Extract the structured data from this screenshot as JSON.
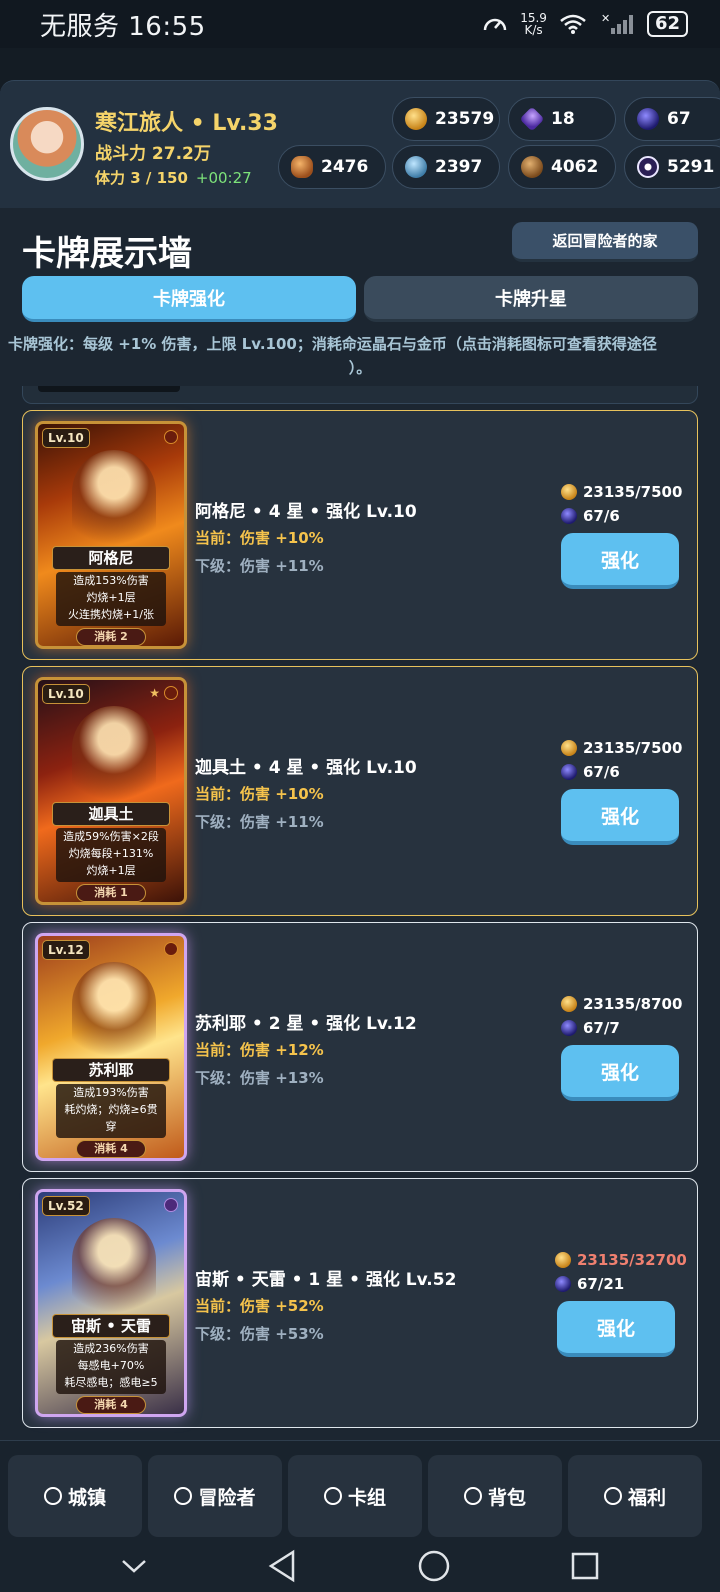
{
  "status_bar": {
    "carrier_time": "无服务 16:55",
    "net_speed_value": "15.9",
    "net_speed_unit": "K/s",
    "battery": "62"
  },
  "player": {
    "name": "寒江旅人 • Lv.33",
    "power": "战斗力 27.2万",
    "stamina": "体力 3 / 150",
    "stamina_timer": "+00:27"
  },
  "resources": {
    "gold": "23579",
    "gem": "18",
    "orb": "67",
    "bread": "2476",
    "crystal": "2397",
    "wood": "4062",
    "dark": "5291"
  },
  "page": {
    "title": "卡牌展示墙",
    "back_button": "返回冒险者的家",
    "tabs": [
      "卡牌强化",
      "卡牌升星"
    ],
    "active_tab": "卡牌强化",
    "hint_line1": "卡牌强化：每级 +1% 伤害，上限 Lv.100；消耗命运晶石与金币（点击消耗图标可查看获得途径",
    "hint_line2": "）。"
  },
  "cards": [
    {
      "level_badge": "Lv.10",
      "name": "阿格尼",
      "effect": [
        "造成153%伤害",
        "灼烧+1层",
        "火连携灼烧+1/张"
      ],
      "cost_badge": "消耗 2",
      "title": "阿格尼 • 4 星 • 强化 Lv.10",
      "current": "当前：伤害 +10%",
      "next": "下级：伤害 +11%",
      "gold_cost": "23135/7500",
      "orb_cost": "67/6",
      "button": "强化"
    },
    {
      "level_badge": "Lv.10",
      "name": "迦具土",
      "effect": [
        "造成59%伤害×2段",
        "灼烧每段+131%",
        "灼烧+1层"
      ],
      "cost_badge": "消耗 1",
      "title": "迦具土 • 4 星 • 强化 Lv.10",
      "current": "当前：伤害 +10%",
      "next": "下级：伤害 +11%",
      "gold_cost": "23135/7500",
      "orb_cost": "67/6",
      "button": "强化"
    },
    {
      "level_badge": "Lv.12",
      "name": "苏利耶",
      "effect": [
        "造成193%伤害",
        "耗灼烧；灼烧≥6贯",
        "穿"
      ],
      "cost_badge": "消耗 4",
      "title": "苏利耶 • 2 星 • 强化 Lv.12",
      "current": "当前：伤害 +12%",
      "next": "下级：伤害 +13%",
      "gold_cost": "23135/8700",
      "orb_cost": "67/7",
      "button": "强化"
    },
    {
      "level_badge": "Lv.52",
      "name": "宙斯 • 天雷",
      "effect": [
        "造成236%伤害",
        "每感电+70%",
        "耗尽感电；感电≥5"
      ],
      "cost_badge": "消耗 4",
      "title": "宙斯 • 天雷 • 1 星 • 强化 Lv.52",
      "current": "当前：伤害 +52%",
      "next": "下级：伤害 +53%",
      "gold_cost": "23135/32700",
      "orb_cost": "67/21",
      "button": "强化"
    }
  ],
  "bottom_nav": [
    "城镇",
    "冒险者",
    "卡组",
    "背包",
    "福利"
  ],
  "colors": {
    "accent": "#5ec0f0",
    "gold_text": "#f5d46a",
    "insufficient": "#f08070",
    "gold_border": "#e7c25c"
  }
}
